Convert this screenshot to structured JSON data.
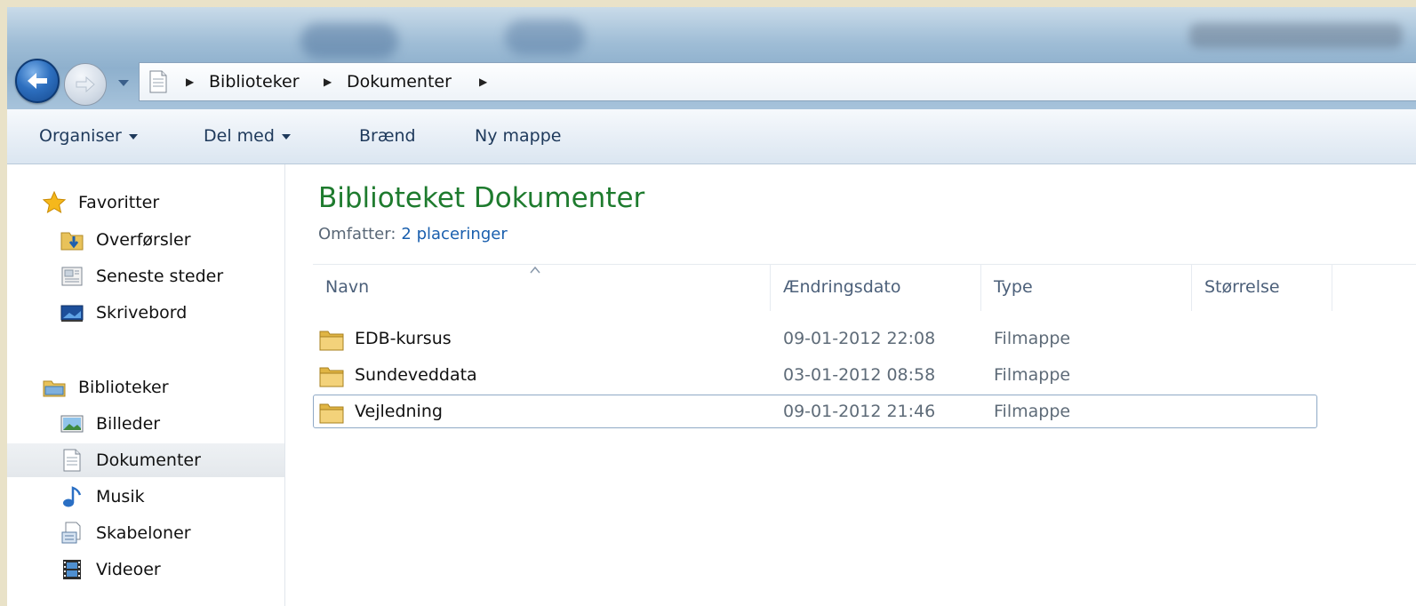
{
  "address": {
    "crumbs": [
      "Biblioteker",
      "Dokumenter"
    ]
  },
  "toolbar": {
    "organise": "Organiser",
    "share": "Del med",
    "burn": "Brænd",
    "new_folder": "Ny mappe"
  },
  "sidebar": {
    "favorites": {
      "label": "Favoritter",
      "items": [
        {
          "label": "Overførsler",
          "icon": "downloads-icon"
        },
        {
          "label": "Seneste steder",
          "icon": "recent-places-icon"
        },
        {
          "label": "Skrivebord",
          "icon": "desktop-icon"
        }
      ]
    },
    "libraries": {
      "label": "Biblioteker",
      "items": [
        {
          "label": "Billeder",
          "icon": "pictures-icon"
        },
        {
          "label": "Dokumenter",
          "icon": "documents-icon",
          "selected": true
        },
        {
          "label": "Musik",
          "icon": "music-icon"
        },
        {
          "label": "Skabeloner",
          "icon": "templates-icon"
        },
        {
          "label": "Videoer",
          "icon": "videos-icon"
        }
      ]
    }
  },
  "library": {
    "title": "Biblioteket Dokumenter",
    "includes_label": "Omfatter:",
    "includes_link": "2 placeringer"
  },
  "columns": {
    "name": "Navn",
    "modified": "Ændringsdato",
    "type": "Type",
    "size": "Størrelse"
  },
  "files": [
    {
      "name": "EDB-kursus",
      "modified": "09-01-2012 22:08",
      "type": "Filmappe"
    },
    {
      "name": "Sundeveddata",
      "modified": "03-01-2012 08:58",
      "type": "Filmappe"
    },
    {
      "name": "Vejledning",
      "modified": "09-01-2012 21:46",
      "type": "Filmappe",
      "focused": true
    }
  ],
  "colors": {
    "library_title": "#1e7b2e",
    "link": "#1a5fae",
    "toolbar_text": "#1e395b"
  }
}
